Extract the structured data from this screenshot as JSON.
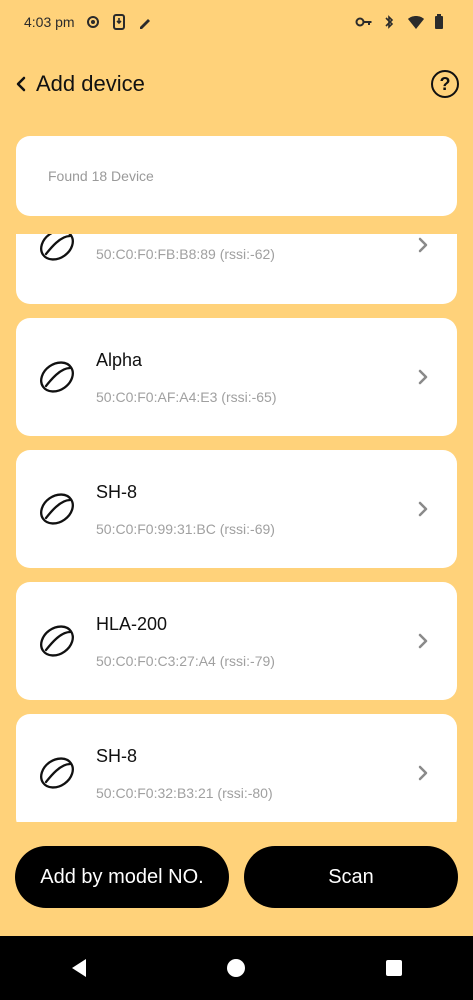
{
  "status": {
    "time": "4:03 pm"
  },
  "header": {
    "title": "Add device"
  },
  "found": {
    "label": "Found 18 Device"
  },
  "devices": [
    {
      "name": "",
      "meta": "50:C0:F0:FB:B8:89 (rssi:-62)"
    },
    {
      "name": "Alpha",
      "meta": "50:C0:F0:AF:A4:E3 (rssi:-65)"
    },
    {
      "name": "SH-8",
      "meta": "50:C0:F0:99:31:BC (rssi:-69)"
    },
    {
      "name": "HLA-200",
      "meta": "50:C0:F0:C3:27:A4 (rssi:-79)"
    },
    {
      "name": "SH-8",
      "meta": "50:C0:F0:32:B3:21 (rssi:-80)"
    }
  ],
  "actions": {
    "add_by_model": "Add by model NO.",
    "scan": "Scan"
  },
  "colors": {
    "background": "#FFD27A",
    "card": "#FFFFFF",
    "button": "#000000"
  }
}
